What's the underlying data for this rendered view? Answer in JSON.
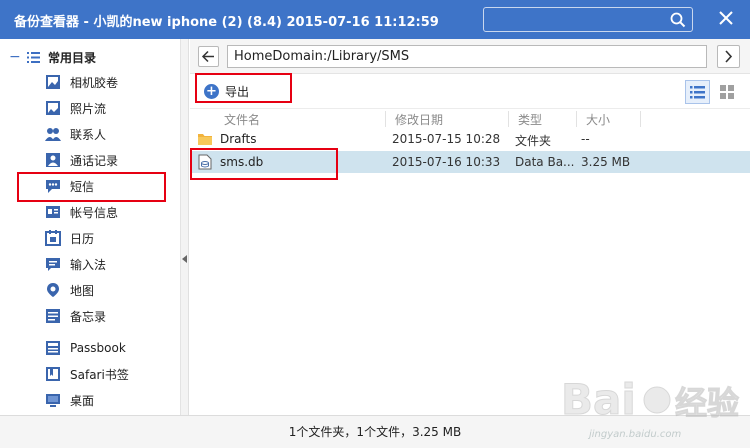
{
  "window": {
    "title": "备份查看器 - 小凯的new iphone (2) (8.4) 2015-07-16 11:12:59",
    "search_placeholder": ""
  },
  "sidebar": {
    "group_label": "常用目录",
    "collapse_symbol": "−",
    "items": [
      {
        "label": "相机胶卷",
        "icon": "photo-icon"
      },
      {
        "label": "照片流",
        "icon": "photostream-icon"
      },
      {
        "label": "联系人",
        "icon": "contacts-icon"
      },
      {
        "label": "通话记录",
        "icon": "call-log-icon"
      },
      {
        "label": "短信",
        "icon": "sms-icon"
      },
      {
        "label": "帐号信息",
        "icon": "account-icon"
      },
      {
        "label": "日历",
        "icon": "calendar-icon"
      },
      {
        "label": "输入法",
        "icon": "keyboard-icon"
      },
      {
        "label": "地图",
        "icon": "map-pin-icon"
      },
      {
        "label": "备忘录",
        "icon": "notes-icon"
      },
      {
        "label": "Passbook",
        "icon": "passbook-icon"
      },
      {
        "label": "Safari书签",
        "icon": "bookmark-icon"
      },
      {
        "label": "桌面",
        "icon": "desktop-icon"
      }
    ]
  },
  "main": {
    "path": "HomeDomain:/Library/SMS",
    "toolbar": {
      "export_label": "导出"
    },
    "columns": [
      "文件名",
      "修改日期",
      "类型",
      "大小"
    ],
    "files": [
      {
        "name": "Drafts",
        "date": "2015-07-15 10:28",
        "type": "文件夹",
        "size": "--",
        "icon": "folder-icon"
      },
      {
        "name": "sms.db",
        "date": "2015-07-16 10:33",
        "type": "Data Ba...",
        "size": "3.25 MB",
        "icon": "database-file-icon"
      }
    ]
  },
  "status": {
    "text": "1个文件夹，1个文件，3.25 MB"
  },
  "watermark": {
    "text": "jingyan.baidu.com"
  },
  "colors": {
    "accent": "#3e74c8",
    "selection": "#cfe3ee",
    "highlight": "#e60012"
  }
}
